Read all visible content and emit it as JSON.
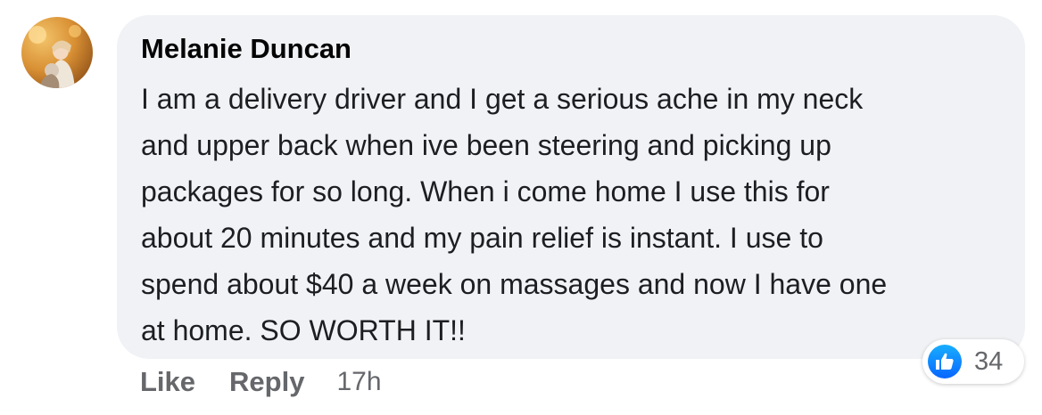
{
  "comment": {
    "author": "Melanie Duncan",
    "lines": [
      "I am a delivery driver and I get a serious ache in my neck",
      "and upper back when ive been steering and picking up",
      "packages for so long. When i come home I use this for",
      "about 20 minutes and my pain relief is instant. I use to",
      "spend about $40 a week on massages and now I have one",
      "at home. SO WORTH IT!!"
    ],
    "reaction_icon": "thumbs-up-icon",
    "reaction_count": "34",
    "bubble_color": "#f0f2f5",
    "reaction_color": "#0866ff"
  },
  "actions": {
    "like_label": "Like",
    "reply_label": "Reply",
    "timestamp": "17h"
  }
}
